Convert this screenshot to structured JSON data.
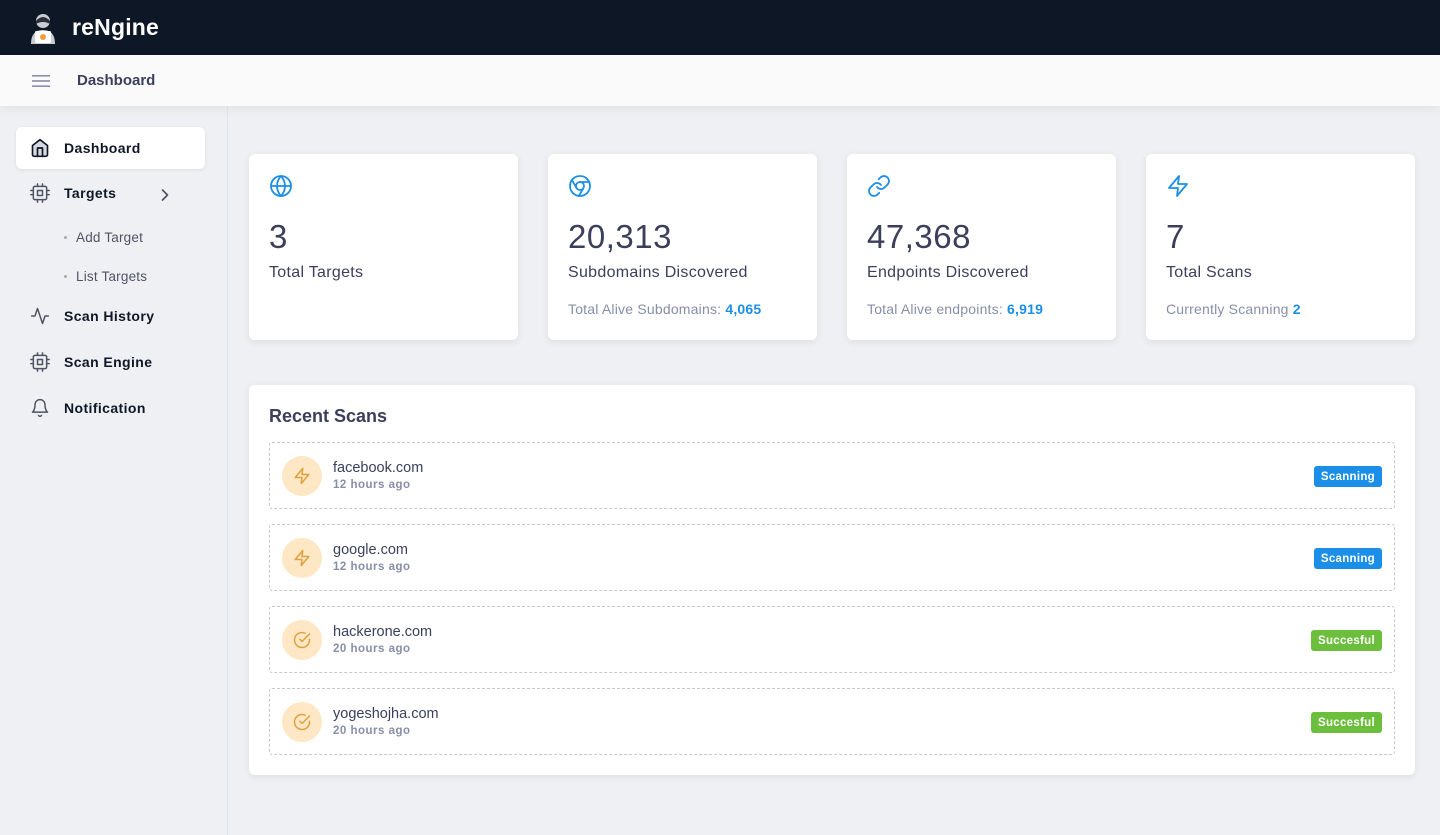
{
  "app": {
    "brand": "reNgine"
  },
  "header": {
    "title": "Dashboard"
  },
  "sidebar": {
    "items": [
      {
        "label": "Dashboard",
        "icon": "home-icon",
        "active": true
      },
      {
        "label": "Targets",
        "icon": "cpu-icon"
      },
      {
        "label": "Scan History",
        "icon": "activity-icon"
      },
      {
        "label": "Scan Engine",
        "icon": "cpu-icon"
      },
      {
        "label": "Notification",
        "icon": "bell-icon"
      }
    ],
    "targets_sub": [
      {
        "label": "Add Target"
      },
      {
        "label": "List Targets"
      }
    ]
  },
  "stats": [
    {
      "icon": "globe-icon",
      "value": "3",
      "label": "Total Targets"
    },
    {
      "icon": "chrome-icon",
      "value": "20,313",
      "label": "Subdomains Discovered",
      "sub_text": "Total Alive Subdomains:",
      "sub_value": "4,065"
    },
    {
      "icon": "link-icon",
      "value": "47,368",
      "label": "Endpoints Discovered",
      "sub_text": "Total Alive endpoints:",
      "sub_value": "6,919"
    },
    {
      "icon": "zap-icon",
      "value": "7",
      "label": "Total Scans",
      "sub_text": "Currently Scanning",
      "sub_value": "2"
    }
  ],
  "recent": {
    "title": "Recent Scans",
    "scans": [
      {
        "domain": "facebook.com",
        "time": "12 hours ago",
        "status": "Scanning",
        "icon": "zap-icon"
      },
      {
        "domain": "google.com",
        "time": "12 hours ago",
        "status": "Scanning",
        "icon": "zap-icon"
      },
      {
        "domain": "hackerone.com",
        "time": "20 hours ago",
        "status": "Succesful",
        "icon": "check-circle-icon"
      },
      {
        "domain": "yogeshojha.com",
        "time": "20 hours ago",
        "status": "Succesful",
        "icon": "check-circle-icon"
      }
    ]
  },
  "colors": {
    "topbar": "#0e1726",
    "accent_blue": "#1b8fe7",
    "success_green": "#6cbe3d",
    "scan_icon_bg": "#fde7c4",
    "scan_icon_fg": "#e2a03f"
  }
}
